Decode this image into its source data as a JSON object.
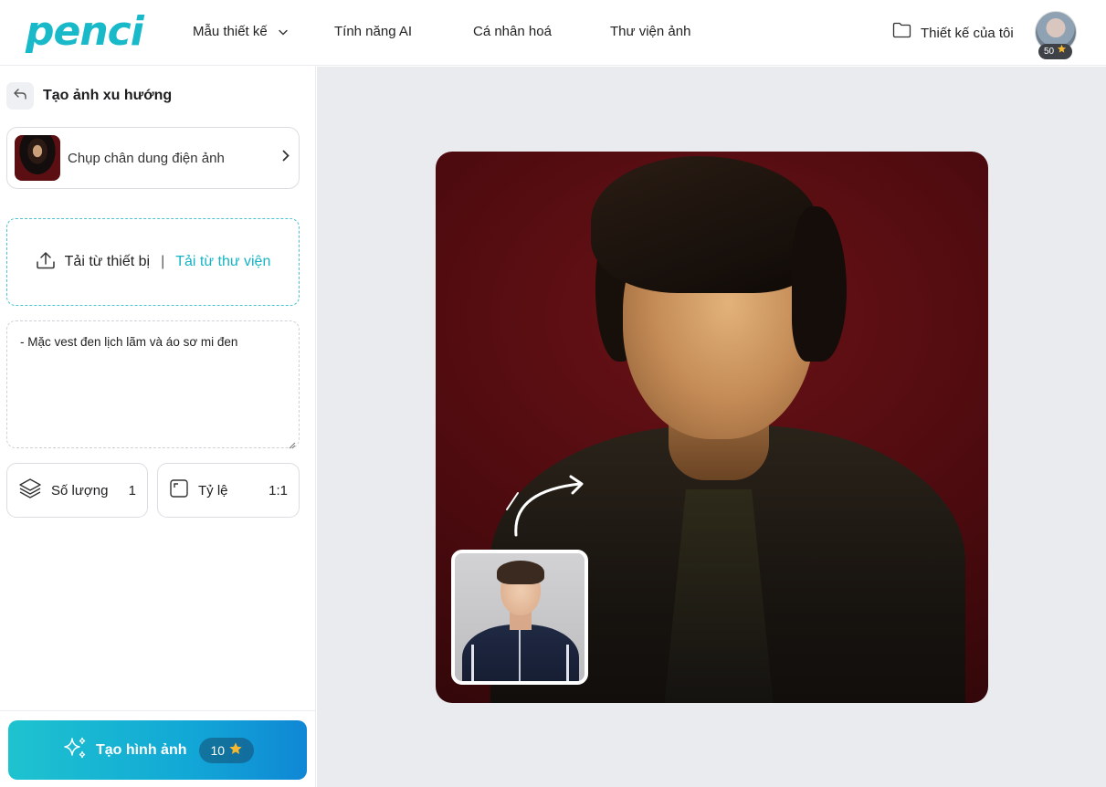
{
  "header": {
    "logo_text": "penci",
    "nav": {
      "templates": "Mẫu thiết kế",
      "ai_features": "Tính năng AI",
      "personalize": "Cá nhân hoá",
      "image_library": "Thư viện ảnh"
    },
    "my_designs": "Thiết kế của tôi",
    "credits": "50"
  },
  "sidebar": {
    "title": "Tạo ảnh xu hướng",
    "template_name": "Chụp chân dung điện ảnh",
    "upload": {
      "from_device": "Tải từ thiết bị",
      "separator": "|",
      "from_library": "Tải từ thư viện"
    },
    "prompt_text": "- Mặc vest đen lịch lãm và áo sơ mi đen",
    "quantity": {
      "label": "Số lượng",
      "value": "1"
    },
    "ratio": {
      "label": "Tỷ lệ",
      "value": "1:1"
    },
    "generate": {
      "label": "Tạo hình ảnh",
      "cost": "10"
    }
  },
  "icons": {
    "logo": "penci-logo",
    "nav_chevron": "chevron-down-icon",
    "folder": "folder-icon",
    "star": "star-icon",
    "back": "back-arrow-icon",
    "chevron_right": "chevron-right-icon",
    "upload": "upload-icon",
    "layers": "layers-icon",
    "ratio": "aspect-ratio-icon",
    "sparkles": "sparkles-icon"
  },
  "colors": {
    "brand": "#18b9c9",
    "accent_link": "#14b3c4",
    "button_gradient_start": "#1ec3cf",
    "button_gradient_end": "#1087d5",
    "canvas_bg": "#eaebef",
    "star": "#f5b82e"
  }
}
